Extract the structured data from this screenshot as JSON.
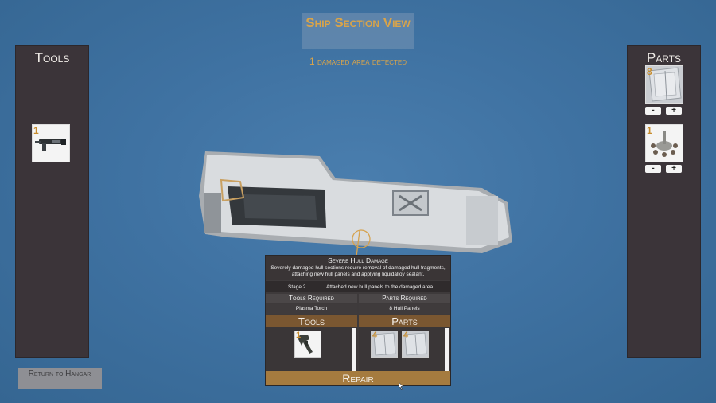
{
  "header": {
    "title": "Ship Section View",
    "damage_status": "1 damaged area detected"
  },
  "tools_panel": {
    "title": "Tools",
    "items": [
      {
        "count": "1",
        "icon": "plasma-torch-icon"
      }
    ]
  },
  "parts_panel": {
    "title": "Parts",
    "items": [
      {
        "count": "8",
        "icon": "hull-panel-icon",
        "minus": "-",
        "plus": "+"
      },
      {
        "count": "1",
        "icon": "liquidalloy-sealant-icon",
        "minus": "-",
        "plus": "+"
      }
    ]
  },
  "repair_popup": {
    "damage_name": "Severe Hull Damage",
    "description": "Severely damaged hull sections require removal of damaged hull fragments, attaching new hull panels and applying liquidalloy sealant.",
    "stage_label": "Stage 2",
    "stage_text": "Attached new hull panels to the damaged area.",
    "tools_required_header": "Tools Required",
    "parts_required_header": "Parts Required",
    "tools_required_value": "Plasma Torch",
    "parts_required_value": "8 Hull Panels",
    "tools_tab": "Tools",
    "parts_tab": "Parts",
    "tool_slots": [
      {
        "count": "1",
        "icon": "plasma-torch-icon"
      }
    ],
    "part_slots": [
      {
        "count": "4",
        "icon": "hull-panel-icon"
      },
      {
        "count": "4",
        "icon": "hull-panel-icon"
      }
    ],
    "repair_button": "Repair"
  },
  "footer": {
    "return_button": "Return to Hangar"
  },
  "colors": {
    "background": "#3f72a2",
    "accent_gold": "#d9a44a",
    "panel": "#3b3439",
    "repair_button": "#a57b3f",
    "tab_brown": "#7a5731"
  }
}
